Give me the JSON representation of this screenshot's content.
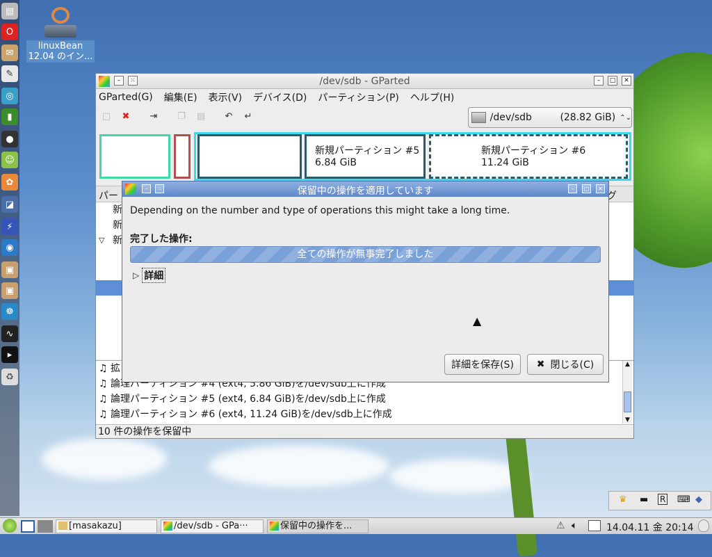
{
  "desktop": {
    "icon_label_1": "linuxBean",
    "icon_label_2": "12.04 のイン..."
  },
  "main_window": {
    "title": "/dev/sdb - GParted",
    "menu": [
      {
        "label": "GParted(G)"
      },
      {
        "label": "編集(E)"
      },
      {
        "label": "表示(V)"
      },
      {
        "label": "デバイス(D)"
      },
      {
        "label": "パーティション(P)"
      },
      {
        "label": "ヘルプ(H)"
      }
    ],
    "device_selector": {
      "device": "/dev/sdb",
      "size": "(28.82 GiB)"
    },
    "partitions": [
      {
        "name": "新規パーティション #5",
        "size": "6.84 GiB"
      },
      {
        "name": "新規パーティション #6",
        "size": "11.24 GiB"
      }
    ],
    "list_header_left": "パー",
    "list_header_right": "グ",
    "list_rows": [
      "新",
      "新",
      "新"
    ],
    "operations": [
      "拡",
      "論理パーティション #4 (ext4, 5.86 GiB)を/dev/sdb上に作成",
      "論理パーティション #5 (ext4, 6.84 GiB)を/dev/sdb上に作成",
      "論理パーティション #6 (ext4, 11.24 GiB)を/dev/sdb上に作成"
    ],
    "status": "10 件の操作を保留中"
  },
  "dialog": {
    "title": "保留中の操作を適用しています",
    "message": "Depending on the number and type of operations this might take a long time.",
    "completed_label": "完了した操作:",
    "progress_text": "全ての操作が無事完了しました",
    "progress_fraction": 1.0,
    "details_label": "詳細",
    "save_button": "詳細を保存(S)",
    "close_button": "閉じる(C)"
  },
  "taskbar": {
    "tasks": [
      {
        "label": "[masakazu]"
      },
      {
        "label": "/dev/sdb - GPa···"
      },
      {
        "label": "保留中の操作を..."
      }
    ],
    "clock": "14.04.11 金 20:14"
  },
  "colors": {
    "selection": "#5e8fd6",
    "progress": "#7aa0d8",
    "partition_border_green": "#3fd6a8",
    "partition_border_red": "#b05050",
    "partition_border_teal": "#2a5a6a",
    "partition_border_cyan": "#40d8e8"
  }
}
